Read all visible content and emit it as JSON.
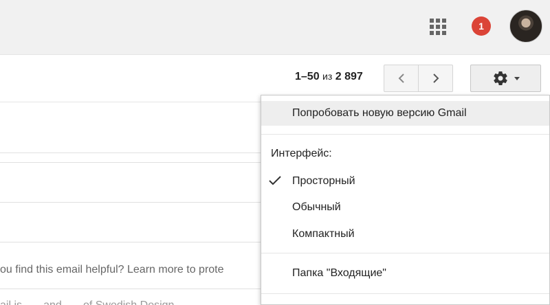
{
  "header": {
    "apps_icon": "apps-grid-icon",
    "notification_count": "1",
    "avatar_icon": "user-avatar"
  },
  "toolbar": {
    "pager": {
      "range": "1–50",
      "of": "из",
      "total": "2 897"
    },
    "prev_icon": "chevron-left-icon",
    "next_icon": "chevron-right-icon",
    "settings_icon": "gear-icon"
  },
  "email_list": {
    "snippets": [
      "ou find this email helpful? Learn more to prote",
      "ail is...... and...... of Swedish Design..."
    ]
  },
  "settings_menu": {
    "try_new": "Попробовать новую версию Gmail",
    "interface_label": "Интерфейс:",
    "density_options": [
      {
        "label": "Просторный",
        "selected": true
      },
      {
        "label": "Обычный",
        "selected": false
      },
      {
        "label": "Компактный",
        "selected": false
      }
    ],
    "inbox_folder": "Папка \"Входящие\""
  },
  "colors": {
    "notification_badge": "#db4437",
    "highlight": "#eeeeee",
    "topbar_bg": "#f1f1f1"
  }
}
